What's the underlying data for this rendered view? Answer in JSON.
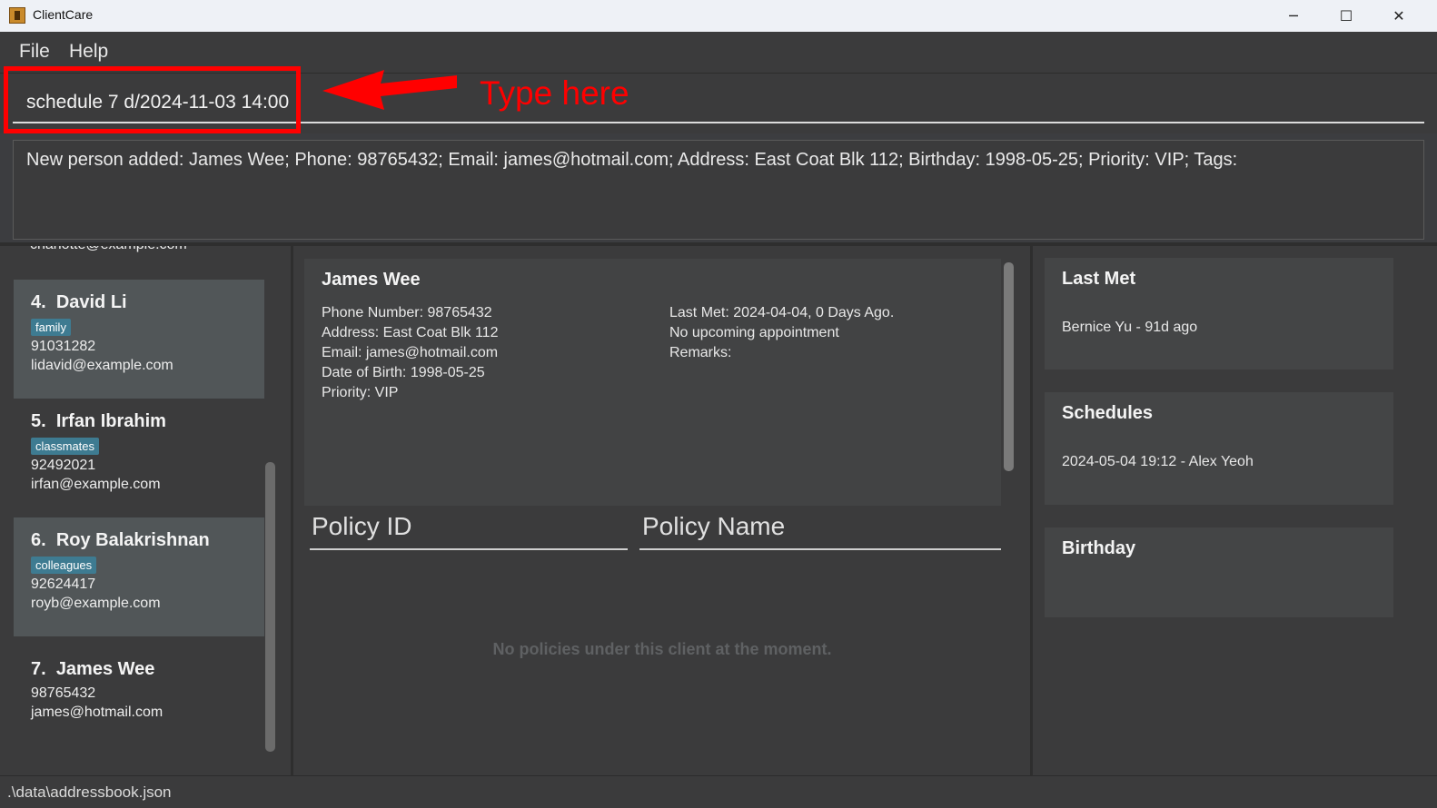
{
  "window": {
    "title": "ClientCare",
    "minimize_glyph": "─",
    "maximize_glyph": "☐",
    "close_glyph": "✕"
  },
  "menu": {
    "file": "File",
    "help": "Help"
  },
  "command": {
    "value": "schedule 7 d/2024-11-03 14:00"
  },
  "annotation": {
    "label": "Type here",
    "color": "#ff0000"
  },
  "result": {
    "text": "New person added: James Wee; Phone: 98765432; Email: james@hotmail.com; Address: East Coat Blk 112; Birthday: 1998-05-25; Priority: VIP; Tags:"
  },
  "person_list": {
    "partial_email": "charlotte@example.com",
    "items": [
      {
        "index": "4.",
        "name": "David Li",
        "tag": "family",
        "phone": "91031282",
        "email": "lidavid@example.com"
      },
      {
        "index": "5.",
        "name": "Irfan Ibrahim",
        "tag": "classmates",
        "phone": "92492021",
        "email": "irfan@example.com"
      },
      {
        "index": "6.",
        "name": "Roy Balakrishnan",
        "tag": "colleagues",
        "phone": "92624417",
        "email": "royb@example.com"
      },
      {
        "index": "7.",
        "name": "James Wee",
        "tag": "",
        "phone": "98765432",
        "email": "james@hotmail.com"
      }
    ]
  },
  "detail": {
    "name": "James Wee",
    "phone": "Phone Number: 98765432",
    "address": "Address: East Coat Blk 112",
    "email": "Email: james@hotmail.com",
    "dob": "Date of Birth: 1998-05-25",
    "priority": "Priority: VIP",
    "last_met": "Last Met: 2024-04-04, 0 Days Ago.",
    "appointment": "No upcoming appointment",
    "remarks": "Remarks:"
  },
  "policies": {
    "col_id": "Policy ID",
    "col_name": "Policy Name",
    "empty_text": "No policies under this client at the moment."
  },
  "sidebar": {
    "last_met": {
      "title": "Last Met",
      "entry": "Bernice Yu - 91d ago"
    },
    "schedules": {
      "title": "Schedules",
      "entry": "2024-05-04 19:12 - Alex Yeoh"
    },
    "birthday": {
      "title": "Birthday",
      "entry": ""
    }
  },
  "status": {
    "path": ".\\data\\addressbook.json"
  },
  "colors": {
    "tag_bg": "#3e7b91",
    "selected_card": "#515658",
    "background": "#3b3b3c"
  }
}
